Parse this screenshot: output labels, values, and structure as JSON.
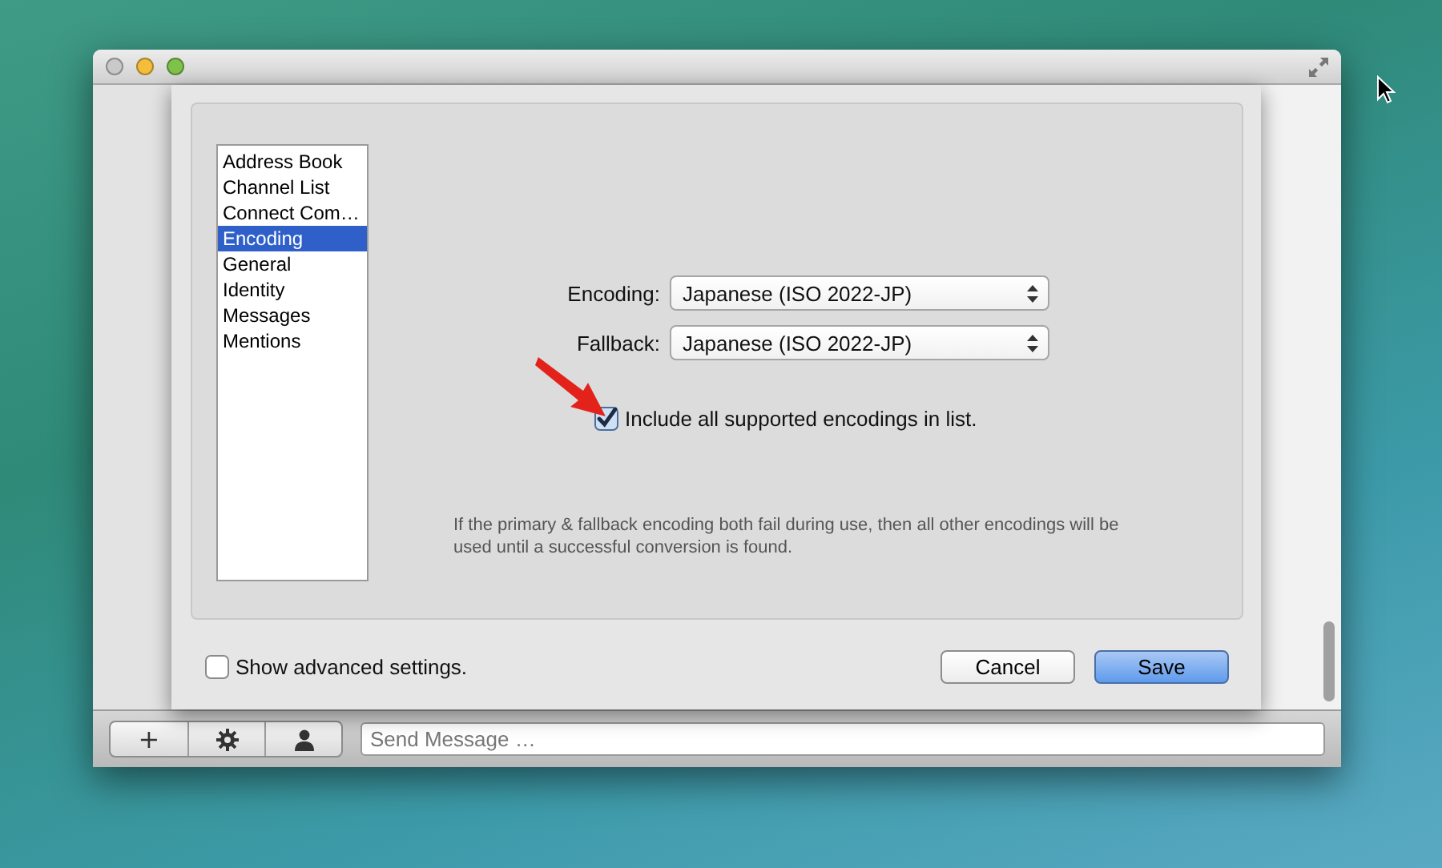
{
  "sheet": {
    "categories": [
      {
        "label": "Address Book",
        "selected": false
      },
      {
        "label": "Channel List",
        "selected": false
      },
      {
        "label": "Connect Com…",
        "selected": false
      },
      {
        "label": "Encoding",
        "selected": true
      },
      {
        "label": "General",
        "selected": false
      },
      {
        "label": "Identity",
        "selected": false
      },
      {
        "label": "Messages",
        "selected": false
      },
      {
        "label": "Mentions",
        "selected": false
      }
    ],
    "popups": [
      {
        "label": "Encoding:",
        "value": "Japanese (ISO 2022-JP)"
      },
      {
        "label": "Fallback:",
        "value": "Japanese (ISO 2022-JP)"
      }
    ],
    "include_all": {
      "label": "Include all supported encodings in list.",
      "checked": true
    },
    "hint": "If the primary & fallback encoding both fail during use, then all other encodings will be used until a successful conversion is found.",
    "advanced": {
      "label": "Show advanced settings.",
      "checked": false
    },
    "buttons": [
      {
        "label": "Cancel",
        "kind": "normal"
      },
      {
        "label": "Save",
        "kind": "default"
      }
    ]
  },
  "composer": {
    "tools": [
      {
        "kind": "text",
        "label": "+"
      },
      {
        "kind": "gear"
      },
      {
        "kind": "person"
      }
    ],
    "message": {
      "placeholder": "Send Message …"
    }
  }
}
